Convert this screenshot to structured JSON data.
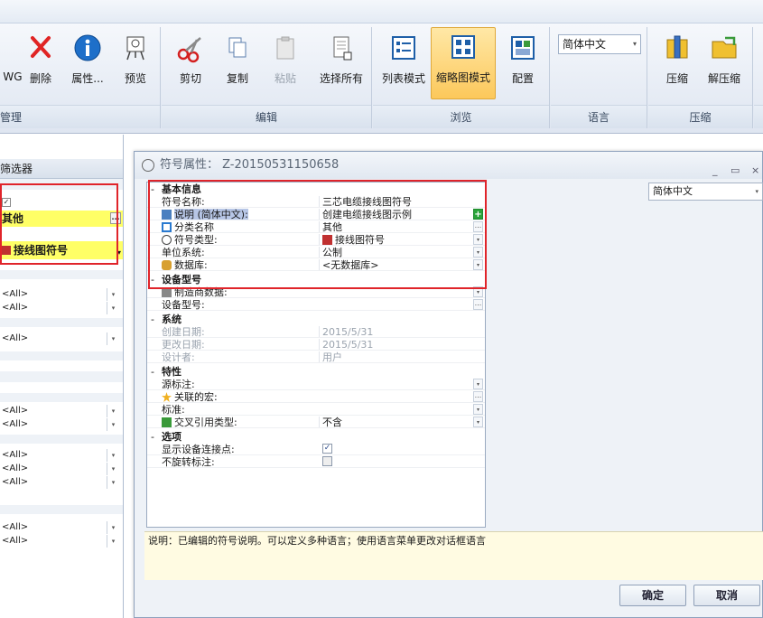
{
  "ribbon": {
    "groups": [
      {
        "label": "管理",
        "buttons": [
          {
            "label": "WG",
            "icon": "dwg-icon"
          },
          {
            "label": "删除",
            "icon": "delete-x-icon"
          },
          {
            "label": "属性...",
            "icon": "info-icon"
          },
          {
            "label": "预览",
            "icon": "preview-easel-icon"
          }
        ]
      },
      {
        "label": "编辑",
        "buttons": [
          {
            "label": "剪切",
            "icon": "scissors-icon"
          },
          {
            "label": "复制",
            "icon": "copy-icon"
          },
          {
            "label": "粘贴",
            "icon": "paste-clipboard-icon"
          },
          {
            "label": "选择所有",
            "icon": "select-all-icon"
          }
        ]
      },
      {
        "label": "浏览",
        "buttons": [
          {
            "label": "列表模式",
            "icon": "list-mode-icon"
          },
          {
            "label": "缩略图模式",
            "icon": "thumbnail-mode-icon"
          },
          {
            "label": "配置",
            "icon": "config-icon"
          }
        ]
      },
      {
        "label": "语言",
        "select_value": "简体中文"
      },
      {
        "label": "压缩",
        "buttons": [
          {
            "label": "压缩",
            "icon": "compress-icon"
          },
          {
            "label": "解压缩",
            "icon": "decompress-icon"
          }
        ]
      }
    ]
  },
  "filter_panel": {
    "title": "筛选器",
    "check": "✓",
    "category": "其他",
    "symbol_type": "接线图符号",
    "all_value": "<All>"
  },
  "dialog": {
    "title": "符号属性： Z-20150531150658",
    "language": "简体中文",
    "sections": {
      "basic": "基本信息",
      "device": "设备型号",
      "system": "系统",
      "traits": "特性",
      "options": "选项"
    },
    "rows": {
      "symbol_name": {
        "key": "符号名称:",
        "value": "三芯电缆接线图符号"
      },
      "description": {
        "key": "说明 (简体中文):",
        "value": "创建电缆接线图示例"
      },
      "category": {
        "key": "分类名称",
        "value": "其他"
      },
      "symbol_type": {
        "key": "符号类型:",
        "value": "接线图符号"
      },
      "unit_system": {
        "key": "单位系统:",
        "value": "公制"
      },
      "database": {
        "key": "数据库:",
        "value": "<无数据库>"
      },
      "manufacturer": {
        "key": "制造商数据:",
        "value": ""
      },
      "device_model": {
        "key": "设备型号:",
        "value": ""
      },
      "created": {
        "key": "创建日期:",
        "value": "2015/5/31"
      },
      "modified": {
        "key": "更改日期:",
        "value": "2015/5/31"
      },
      "designer": {
        "key": "设计者:",
        "value": "用户"
      },
      "source_mark": {
        "key": "源标注:",
        "value": ""
      },
      "macro": {
        "key": "关联的宏:",
        "value": ""
      },
      "standard": {
        "key": "标准:",
        "value": ""
      },
      "cross_ref": {
        "key": "交叉引用类型:",
        "value": "不含"
      },
      "show_points": {
        "key": "显示设备连接点:",
        "checked": "✓"
      },
      "no_rotate": {
        "key": "不旋转标注:",
        "checked": ""
      }
    },
    "description_text": "说明：已编辑的符号说明。可以定义多种语言；使用语言菜单更改对话框语言",
    "ok_label": "确定",
    "cancel_label": "取消"
  },
  "colors": {
    "highlight_yellow": "#ffff66",
    "red_box": "#e0242a",
    "active_button": "#fcc85b"
  }
}
